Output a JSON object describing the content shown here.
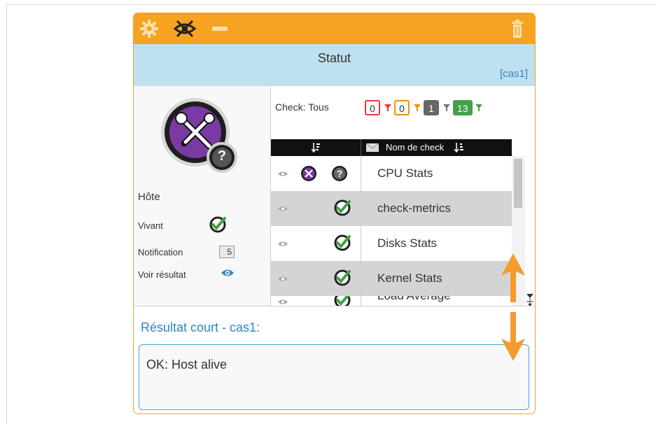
{
  "toolbar": {
    "settings_icon": "gear-icon",
    "hide_icon": "eye-crossed-icon",
    "minimize_icon": "minus-icon",
    "delete_icon": "trash-icon"
  },
  "status": {
    "title": "Statut",
    "host_link": "cas1",
    "bracket_open": "[",
    "bracket_close": "]"
  },
  "host_panel": {
    "host_icon": "tools-icon",
    "unknown_badge": "?",
    "host_label": "Hôte",
    "alive_label": "Vivant",
    "notification_label": "Notification",
    "notification_count": "5",
    "view_result_label": "Voir résultat"
  },
  "checks": {
    "filter_label": "Check: Tous",
    "badges": [
      {
        "count": "0",
        "color": "#e53935"
      },
      {
        "count": "0",
        "color": "#fb8c00"
      },
      {
        "count": "1",
        "color": "#666666"
      },
      {
        "count": "13",
        "color": "#43a047"
      }
    ],
    "column_header": "Nom de check",
    "rows": [
      {
        "name": "CPU Stats",
        "state": "unknown",
        "grey": false
      },
      {
        "name": "check-metrics",
        "state": "ok",
        "grey": true
      },
      {
        "name": "Disks Stats",
        "state": "ok",
        "grey": false
      },
      {
        "name": "Kernel Stats",
        "state": "ok",
        "grey": true
      },
      {
        "name": "Load Average",
        "state": "ok",
        "grey": false
      }
    ]
  },
  "result": {
    "title": "Résultat court - cas1:",
    "text": "OK: Host alive"
  },
  "colors": {
    "toolbar": "#f5a321",
    "status_bar": "#bfe0f0",
    "accent": "#2e86c1",
    "arrow": "#f59a2e"
  }
}
